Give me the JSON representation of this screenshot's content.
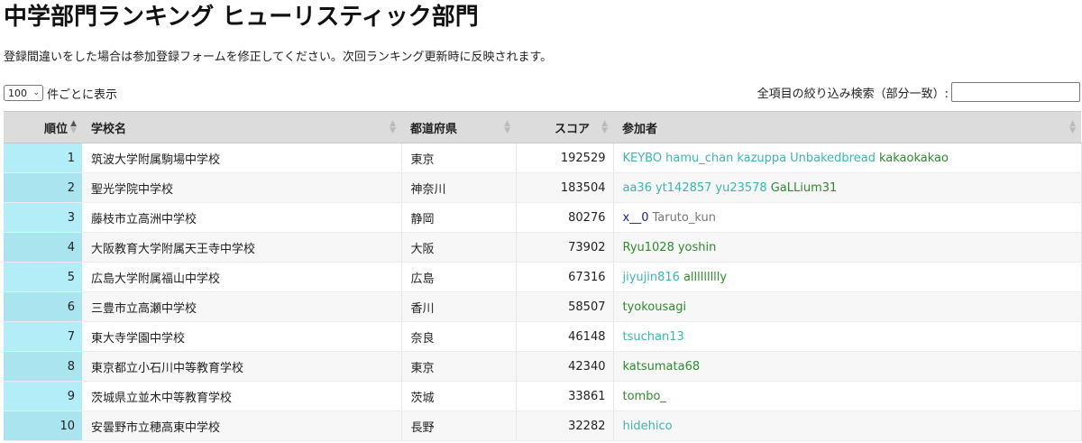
{
  "page": {
    "title": "中学部門ランキング ヒューリスティック部門",
    "notice": "登録間違いをした場合は参加登録フォームを修正してください。次回ランキング更新時に反映されます。"
  },
  "length_menu": {
    "value": "100",
    "suffix": "件ごとに表示"
  },
  "search": {
    "label": "全項目の絞り込み検索（部分一致）:",
    "value": ""
  },
  "table": {
    "headers": {
      "rank": "順位",
      "school": "学校名",
      "prefecture": "都道府県",
      "score": "スコア",
      "participants": "参加者"
    },
    "rows": [
      {
        "rank": "1",
        "school": "筑波大学附属駒場中学校",
        "prefecture": "東京",
        "score": "192529",
        "participants": [
          {
            "name": "KEYBO",
            "color": "cyan"
          },
          {
            "name": "hamu_chan",
            "color": "cyan"
          },
          {
            "name": "kazuppa",
            "color": "cyan"
          },
          {
            "name": "Unbakedbread",
            "color": "cyan"
          },
          {
            "name": "kakaokakao",
            "color": "green"
          }
        ]
      },
      {
        "rank": "2",
        "school": "聖光学院中学校",
        "prefecture": "神奈川",
        "score": "183504",
        "participants": [
          {
            "name": "aa36",
            "color": "cyan"
          },
          {
            "name": "yt142857",
            "color": "cyan"
          },
          {
            "name": "yu23578",
            "color": "cyan"
          },
          {
            "name": "GaLLium31",
            "color": "green"
          }
        ]
      },
      {
        "rank": "3",
        "school": "藤枝市立高洲中学校",
        "prefecture": "静岡",
        "score": "80276",
        "participants": [
          {
            "name": "x__0",
            "color": "navy"
          },
          {
            "name": "Taruto_kun",
            "color": "gray"
          }
        ]
      },
      {
        "rank": "4",
        "school": "大阪教育大学附属天王寺中学校",
        "prefecture": "大阪",
        "score": "73902",
        "participants": [
          {
            "name": "Ryu1028",
            "color": "green"
          },
          {
            "name": "yoshin",
            "color": "green"
          }
        ]
      },
      {
        "rank": "5",
        "school": "広島大学附属福山中学校",
        "prefecture": "広島",
        "score": "67316",
        "participants": [
          {
            "name": "jiyujin816",
            "color": "cyan"
          },
          {
            "name": "allllllllly",
            "color": "green"
          }
        ]
      },
      {
        "rank": "6",
        "school": "三豊市立高瀬中学校",
        "prefecture": "香川",
        "score": "58507",
        "participants": [
          {
            "name": "tyokousagi",
            "color": "green"
          }
        ]
      },
      {
        "rank": "7",
        "school": "東大寺学園中学校",
        "prefecture": "奈良",
        "score": "46148",
        "participants": [
          {
            "name": "tsuchan13",
            "color": "cyan"
          }
        ]
      },
      {
        "rank": "8",
        "school": "東京都立小石川中等教育学校",
        "prefecture": "東京",
        "score": "42340",
        "participants": [
          {
            "name": "katsumata68",
            "color": "green"
          }
        ]
      },
      {
        "rank": "9",
        "school": "茨城県立並木中等教育学校",
        "prefecture": "茨城",
        "score": "33861",
        "participants": [
          {
            "name": "tombo_",
            "color": "green"
          }
        ]
      },
      {
        "rank": "10",
        "school": "安曇野市立穂高東中学校",
        "prefecture": "長野",
        "score": "32282",
        "participants": [
          {
            "name": "hidehico",
            "color": "cyan"
          }
        ]
      }
    ]
  },
  "colors": {
    "cyan": "#3ab5b0",
    "green": "#2e8b2e",
    "navy": "#1a1aaa",
    "gray": "#777777",
    "rank_bg": "#b3edf7",
    "header_bg": "#dcdcdc"
  },
  "icons": {
    "sort_both": "sort-both-icon",
    "sort_asc": "sort-asc-icon",
    "select_chevron": "chevron-down-icon"
  }
}
